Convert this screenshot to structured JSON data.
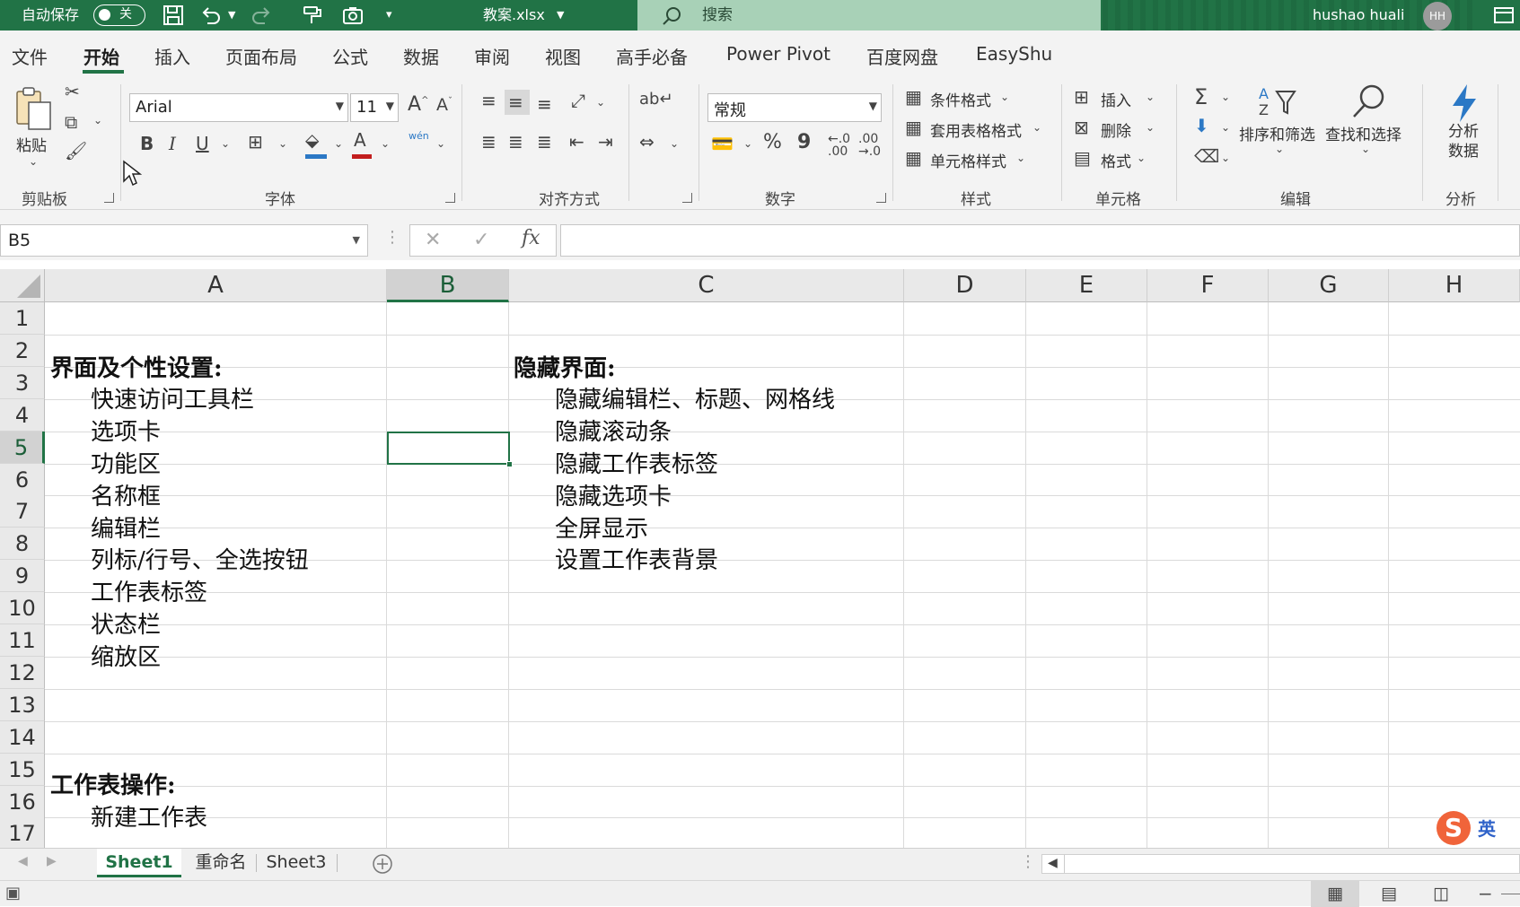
{
  "titlebar": {
    "autosave_label": "自动保存",
    "autosave_state": "关",
    "filename": "教案.xlsx",
    "search_placeholder": "搜索",
    "user_name": "hushao huali",
    "user_initials": "HH"
  },
  "menu": {
    "tabs": [
      "文件",
      "开始",
      "插入",
      "页面布局",
      "公式",
      "数据",
      "审阅",
      "视图",
      "高手必备",
      "Power Pivot",
      "百度网盘",
      "EasyShu"
    ],
    "active": "开始"
  },
  "ribbon": {
    "clipboard": {
      "paste": "粘贴",
      "label": "剪贴板"
    },
    "font": {
      "name": "Arial",
      "size": "11",
      "label": "字体",
      "bold": "B",
      "italic": "I",
      "underline": "U",
      "phonetic": "wén"
    },
    "alignment": {
      "label": "对齐方式"
    },
    "number": {
      "format": "常规",
      "label": "数字",
      "percent": "%",
      "comma": "9"
    },
    "styles": {
      "conditional": "条件格式",
      "table": "套用表格格式",
      "cell": "单元格样式",
      "label": "样式"
    },
    "cells": {
      "insert": "插入",
      "delete": "删除",
      "format": "格式",
      "label": "单元格"
    },
    "editing": {
      "sort": "排序和筛选",
      "find": "查找和选择",
      "label": "编辑"
    },
    "analysis": {
      "analyze": "分析数据",
      "label": "分析"
    }
  },
  "formula_bar": {
    "name_box": "B5",
    "formula": ""
  },
  "grid": {
    "columns": [
      "A",
      "B",
      "C",
      "D",
      "E",
      "F",
      "G",
      "H"
    ],
    "selected_column": "B",
    "rows": [
      "1",
      "2",
      "3",
      "4",
      "5",
      "6",
      "7",
      "8",
      "9",
      "10",
      "11",
      "12",
      "13",
      "14",
      "15",
      "16",
      "17"
    ],
    "selected_row": "5",
    "col_a": {
      "r3": "界面及个性设置:",
      "r4": "快速访问工具栏",
      "r5": "选项卡",
      "r6": "功能区",
      "r7": "名称框",
      "r8": "编辑栏",
      "r9": "列标/行号、全选按钮",
      "r10": "工作表标签",
      "r11": "状态栏",
      "r12": "缩放区",
      "r16": "工作表操作:",
      "r17": "新建工作表"
    },
    "col_c": {
      "r3": "隐藏界面:",
      "r4": "隐藏编辑栏、标题、网格线",
      "r5": "隐藏滚动条",
      "r6": "隐藏工作表标签",
      "r7": "隐藏选项卡",
      "r8": "全屏显示",
      "r9": "设置工作表背景"
    }
  },
  "sheets": {
    "tabs": [
      "Sheet1",
      "重命名",
      "Sheet3"
    ],
    "active": "Sheet1"
  },
  "ime": {
    "logo": "S",
    "mode": "英"
  },
  "colors": {
    "accent": "#217346",
    "search_bg": "#a8d1b7"
  }
}
